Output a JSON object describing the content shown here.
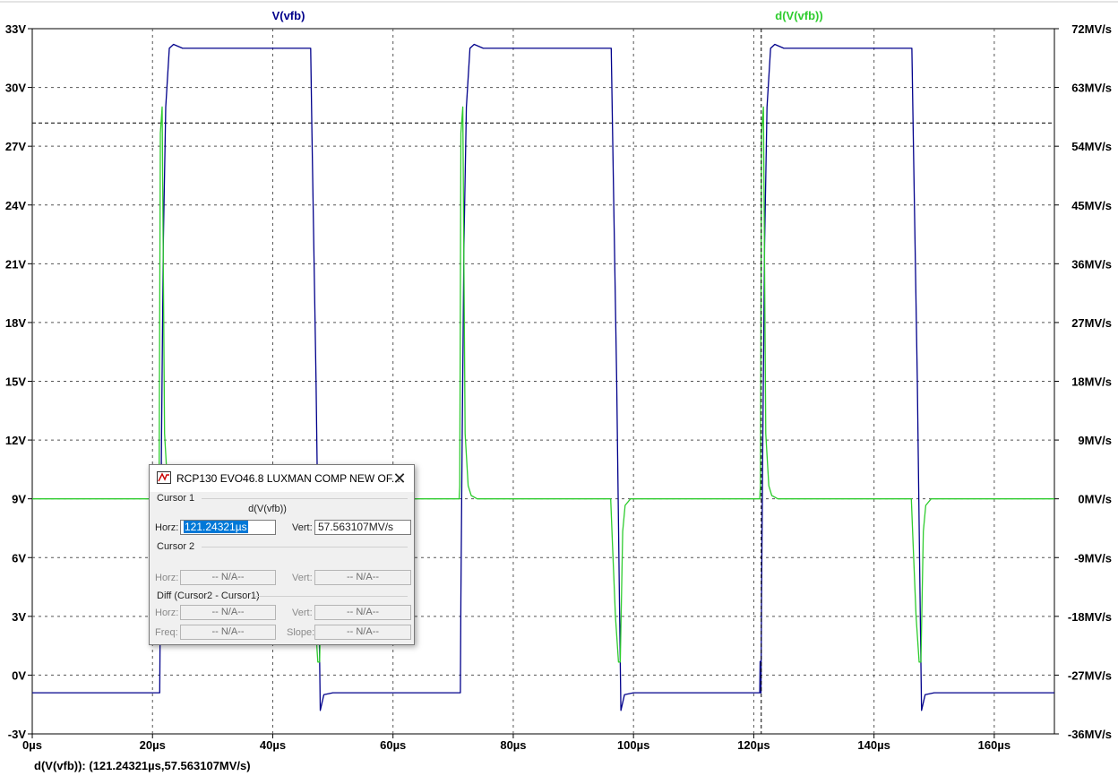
{
  "window": {
    "trace_labels": [
      {
        "text": "V(vfb)",
        "color": "#00008b"
      },
      {
        "text": "d(V(vfb))",
        "color": "#2ecc2e"
      }
    ],
    "status_text": "d(V(vfb)): (121.24321µs,57.563107MV/s)"
  },
  "chart_data": {
    "type": "line",
    "x_ticks": [
      "0µs",
      "20µs",
      "40µs",
      "60µs",
      "80µs",
      "100µs",
      "120µs",
      "140µs",
      "160µs"
    ],
    "xlim": [
      0,
      170
    ],
    "y_left_ticks": [
      "33V",
      "30V",
      "27V",
      "24V",
      "21V",
      "18V",
      "15V",
      "12V",
      "9V",
      "6V",
      "3V",
      "0V",
      "-3V"
    ],
    "ylim_left": [
      -3,
      33
    ],
    "y_right_ticks": [
      "72MV/s",
      "63MV/s",
      "54MV/s",
      "45MV/s",
      "36MV/s",
      "27MV/s",
      "18MV/s",
      "9MV/s",
      "0MV/s",
      "-9MV/s",
      "-18MV/s",
      "-27MV/s",
      "-36MV/s"
    ],
    "ylim_right": [
      -36,
      72
    ],
    "grid": true,
    "series": [
      {
        "name": "V(vfb)",
        "axis": "left",
        "color": "#00008b",
        "points": [
          [
            0,
            -0.9
          ],
          [
            21.2,
            -0.9
          ],
          [
            21.3,
            4
          ],
          [
            21.5,
            12
          ],
          [
            21.8,
            22
          ],
          [
            22.2,
            29
          ],
          [
            22.8,
            32
          ],
          [
            23.5,
            32.2
          ],
          [
            25,
            32
          ],
          [
            46.3,
            32
          ],
          [
            46.5,
            28
          ],
          [
            47.2,
            15
          ],
          [
            47.7,
            3
          ],
          [
            47.9,
            -1.8
          ],
          [
            48.5,
            -1
          ],
          [
            50,
            -0.9
          ],
          [
            71.2,
            -0.9
          ],
          [
            71.3,
            4
          ],
          [
            71.5,
            12
          ],
          [
            71.8,
            22
          ],
          [
            72.2,
            29
          ],
          [
            72.8,
            32
          ],
          [
            73.5,
            32.2
          ],
          [
            75,
            32
          ],
          [
            96.3,
            32
          ],
          [
            96.5,
            28
          ],
          [
            97.2,
            15
          ],
          [
            97.7,
            3
          ],
          [
            97.9,
            -1.8
          ],
          [
            98.5,
            -1
          ],
          [
            100,
            -0.9
          ],
          [
            121,
            -0.9
          ],
          [
            121.05,
            0.7
          ],
          [
            121.1,
            -0.9
          ],
          [
            121.2,
            -0.9
          ],
          [
            121.3,
            4
          ],
          [
            121.5,
            12
          ],
          [
            121.8,
            22
          ],
          [
            122.2,
            29
          ],
          [
            122.8,
            32
          ],
          [
            123.5,
            32.2
          ],
          [
            125,
            32
          ],
          [
            146.3,
            32
          ],
          [
            146.5,
            28
          ],
          [
            147.2,
            15
          ],
          [
            147.7,
            3
          ],
          [
            147.9,
            -1.8
          ],
          [
            148.5,
            -1
          ],
          [
            150,
            -0.9
          ],
          [
            170,
            -0.9
          ]
        ]
      },
      {
        "name": "d(V(vfb))",
        "axis": "right",
        "color": "#2ecc2e",
        "points": [
          [
            0,
            0
          ],
          [
            21,
            0
          ],
          [
            21.1,
            2
          ],
          [
            21.3,
            56
          ],
          [
            21.6,
            60
          ],
          [
            22,
            10
          ],
          [
            22.5,
            2
          ],
          [
            23,
            0.5
          ],
          [
            24,
            0
          ],
          [
            46.2,
            0
          ],
          [
            46.5,
            -7
          ],
          [
            47,
            -18
          ],
          [
            47.5,
            -25
          ],
          [
            47.8,
            -25
          ],
          [
            48.2,
            -5
          ],
          [
            48.6,
            -1
          ],
          [
            49.5,
            0
          ],
          [
            71,
            0
          ],
          [
            71.1,
            2
          ],
          [
            71.3,
            56
          ],
          [
            71.6,
            60
          ],
          [
            72,
            10
          ],
          [
            72.5,
            2
          ],
          [
            73,
            0.5
          ],
          [
            74,
            0
          ],
          [
            96.2,
            0
          ],
          [
            96.5,
            -7
          ],
          [
            97,
            -18
          ],
          [
            97.5,
            -25
          ],
          [
            97.8,
            -25
          ],
          [
            98.2,
            -5
          ],
          [
            98.6,
            -1
          ],
          [
            99.5,
            0
          ],
          [
            121,
            0
          ],
          [
            121.1,
            2
          ],
          [
            121.3,
            56
          ],
          [
            121.6,
            60
          ],
          [
            122,
            10
          ],
          [
            122.5,
            2
          ],
          [
            123,
            0.5
          ],
          [
            124,
            0
          ],
          [
            146.2,
            0
          ],
          [
            146.5,
            -7
          ],
          [
            147,
            -18
          ],
          [
            147.5,
            -25
          ],
          [
            147.8,
            -25
          ],
          [
            148.2,
            -5
          ],
          [
            148.6,
            -1
          ],
          [
            149.5,
            0
          ],
          [
            170,
            0
          ]
        ]
      }
    ],
    "cursor": {
      "x": 121.24321,
      "y": 57.563107
    }
  },
  "dialog": {
    "title": "RCP130 EVO46.8 LUXMAN COMP NEW OF...",
    "close_glyph": "✕",
    "cursor1": {
      "label": "Cursor 1",
      "trace": "d(V(vfb))",
      "horz_label": "Horz:",
      "horz_value": "121.24321µs",
      "vert_label": "Vert:",
      "vert_value": "57.563107MV/s"
    },
    "cursor2": {
      "label": "Cursor 2",
      "horz_label": "Horz:",
      "horz_value": "-- N/A--",
      "vert_label": "Vert:",
      "vert_value": "-- N/A--"
    },
    "diff": {
      "label": "Diff (Cursor2 - Cursor1)",
      "horz_label": "Horz:",
      "horz_value": "-- N/A--",
      "vert_label": "Vert:",
      "vert_value": "-- N/A--",
      "freq_label": "Freq:",
      "freq_value": "-- N/A--",
      "slope_label": "Slope:",
      "slope_value": "-- N/A--"
    }
  }
}
